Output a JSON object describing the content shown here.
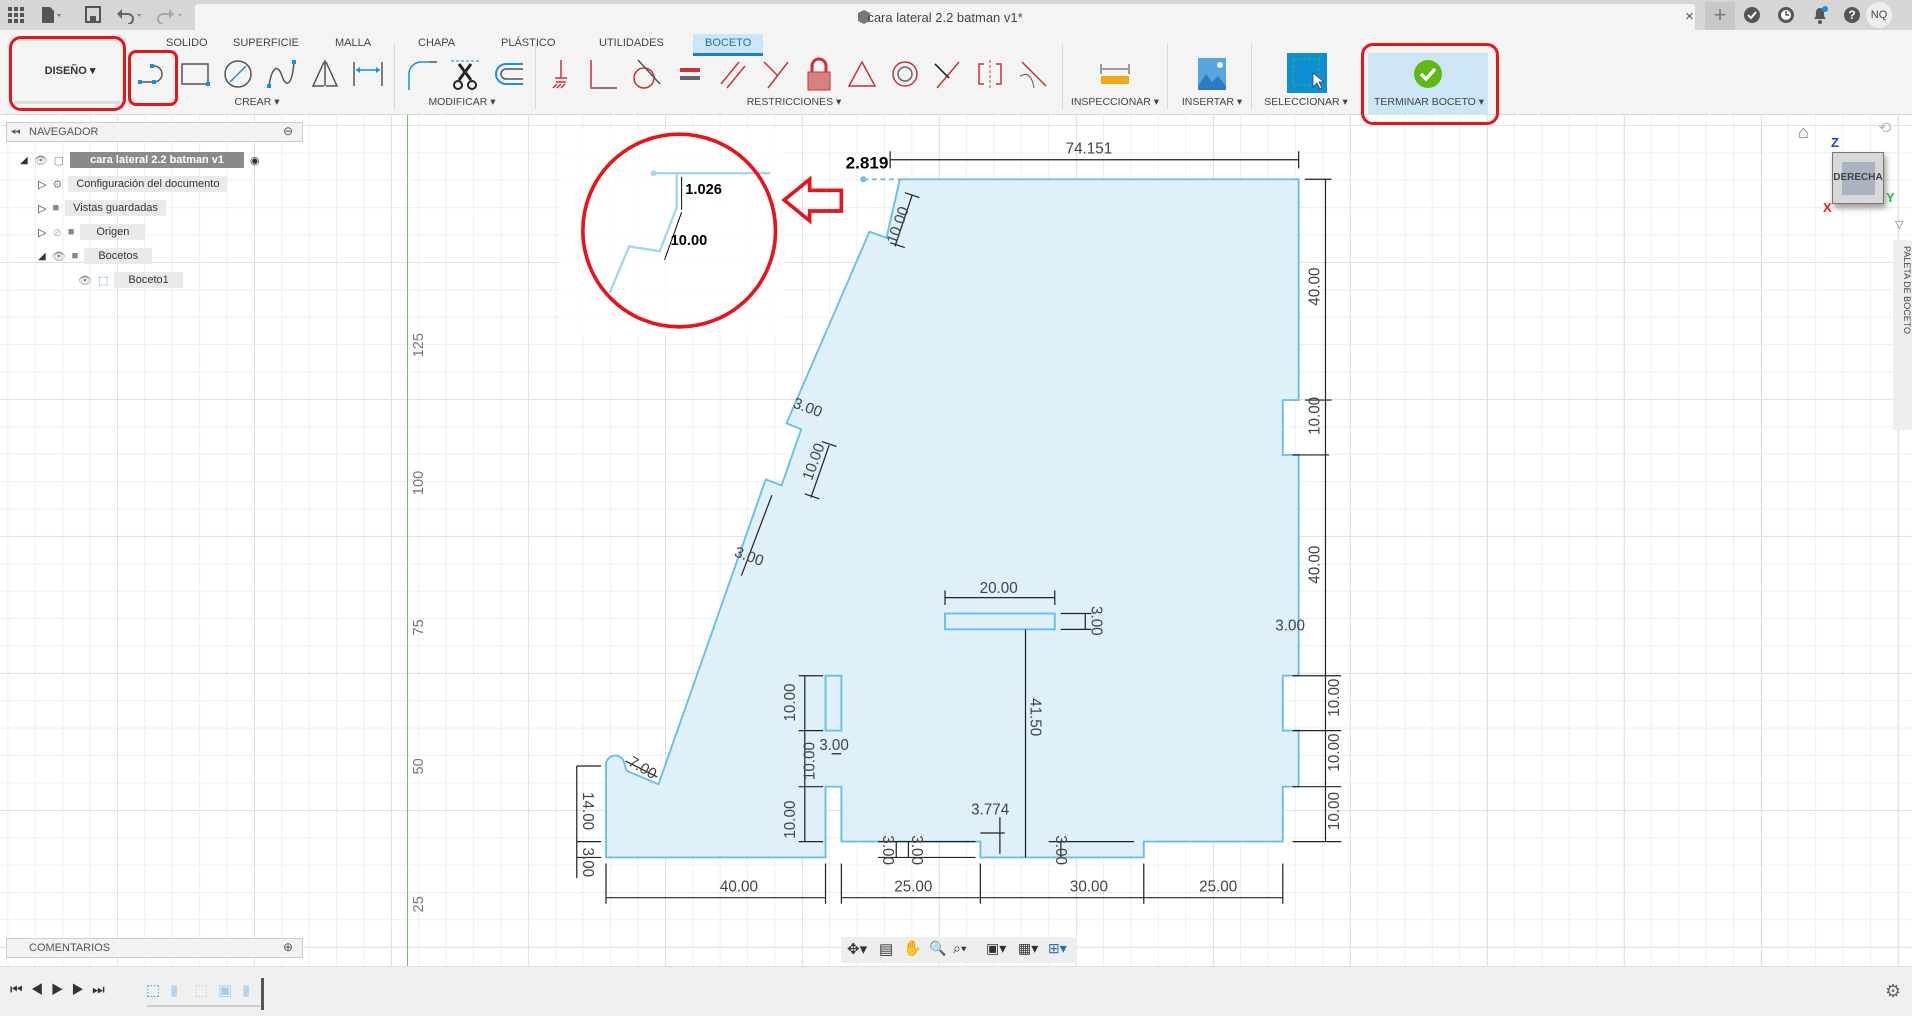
{
  "window": {
    "title": "cara lateral 2.2 batman v1*",
    "user_initials": "NQ"
  },
  "workspace": {
    "label": "DISEÑO"
  },
  "tabs": [
    "SOLIDO",
    "SUPERFICIE",
    "MALLA",
    "CHAPA",
    "PLÁSTICO",
    "UTILIDADES",
    "BOCETO"
  ],
  "active_tab": "BOCETO",
  "groups": {
    "create": "CREAR",
    "modify": "MODIFICAR",
    "constraints": "RESTRICCIONES",
    "inspect": "INSPECCIONAR",
    "insert": "INSERTAR",
    "select": "SELECCIONAR",
    "finish": "TERMINAR BOCETO"
  },
  "navigator": {
    "title": "NAVEGADOR",
    "items": [
      {
        "label": "cara lateral 2.2 batman v1"
      },
      {
        "label": "Configuración del documento"
      },
      {
        "label": "Vistas guardadas"
      },
      {
        "label": "Origen"
      },
      {
        "label": "Bocetos"
      },
      {
        "label": "Boceto1"
      }
    ]
  },
  "comments": {
    "title": "COMENTARIOS"
  },
  "viewcube": {
    "face": "DERECHA",
    "axes": [
      "Z",
      "X",
      "Y"
    ]
  },
  "palette": {
    "label": "PALETA DE BOCETO"
  },
  "ruler": [
    "125",
    "100",
    "75",
    "50",
    "25"
  ],
  "colors": {
    "accent": "#1a7fd0",
    "sketch_fill": "#dff0f9",
    "sketch_line": "#6cc0e6",
    "annotation": "#e8141c",
    "finish_green": "#5fba17"
  },
  "dims": {
    "d2819": "2.819",
    "d74151": "74.151",
    "top10": "10.00",
    "r40a": "40.00",
    "r10a": "10.00",
    "r40b": "40.00",
    "r3": "3.00",
    "r10b": "10.00",
    "r10c": "10.00",
    "r10d": "10.00",
    "s20": "20.00",
    "s3": "3.00",
    "s4150": "41.50",
    "l3a": "3.00",
    "l10": "10.00",
    "l3b": "3.00",
    "v10a": "10.00",
    "v3": "3.00",
    "v10b": "10.00",
    "v10c": "10.00",
    "r7": "7.00",
    "h14": "14.00",
    "h3": "3.00",
    "d3774": "3.774",
    "b3a": "3.00",
    "b3b": "3.00",
    "b3c": "3.00",
    "b40": "40.00",
    "b25a": "25.00",
    "b30": "30.00",
    "b25b": "25.00",
    "inset1026": "1.026",
    "inset10": "10.00"
  }
}
